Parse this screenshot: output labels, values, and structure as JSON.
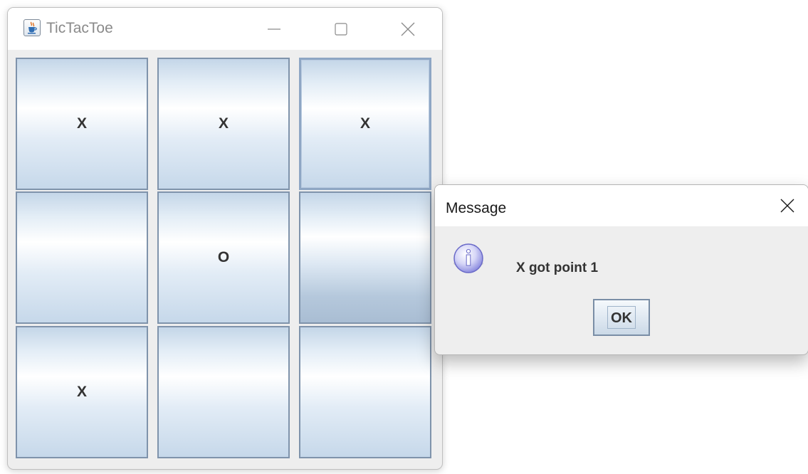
{
  "window": {
    "title": "TicTacToe",
    "app_icon": "java-cup-icon"
  },
  "board": {
    "cells": [
      "X",
      "X",
      "X",
      "",
      "O",
      "",
      "X",
      "",
      ""
    ]
  },
  "dialog": {
    "title": "Message",
    "icon": "info-icon",
    "message": "X got point 1",
    "ok_label": "OK"
  },
  "colors": {
    "cell_border": "#7f93ab",
    "cell_gradient_edge": "#c4d6e8",
    "dialog_background": "#eeeeee",
    "info_icon": "#8f8fe0"
  }
}
